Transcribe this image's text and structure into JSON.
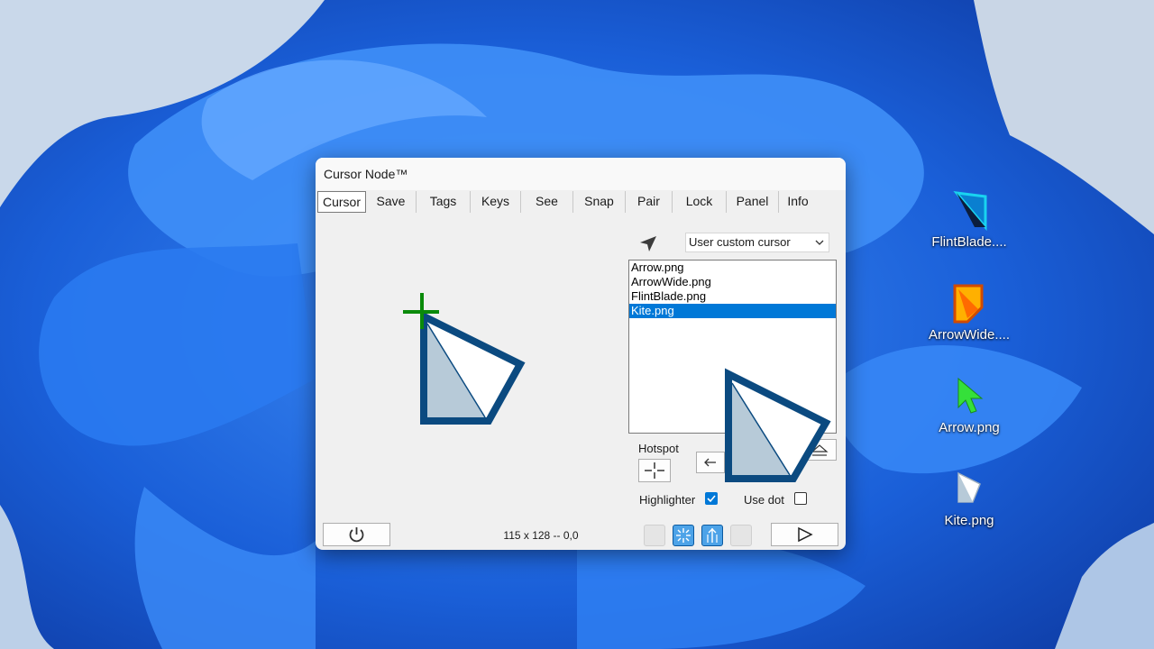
{
  "window": {
    "title": "Cursor Node™"
  },
  "tabs": [
    {
      "label": "Cursor",
      "active": true
    },
    {
      "label": "Save"
    },
    {
      "label": "Tags"
    },
    {
      "label": "Keys"
    },
    {
      "label": "See"
    },
    {
      "label": "Snap"
    },
    {
      "label": "Pair"
    },
    {
      "label": "Lock"
    },
    {
      "label": "Panel"
    },
    {
      "label": "Info"
    }
  ],
  "cursor_source": {
    "selected": "User custom cursor"
  },
  "cursor_files": [
    {
      "name": "Arrow.png"
    },
    {
      "name": "ArrowWide.png"
    },
    {
      "name": "FlintBlade.png"
    },
    {
      "name": "Kite.png",
      "selected": true
    }
  ],
  "hotspot": {
    "label": "Hotspot"
  },
  "options": {
    "highlighter_label": "Highlighter",
    "highlighter_checked": true,
    "use_dot_label": "Use dot",
    "use_dot_checked": false
  },
  "status": {
    "text": "115 x 128 -- 0,0"
  },
  "colors": {
    "accent": "#0078d7",
    "cursor_outline": "#0b4a80",
    "cursor_shade": "#b7cad8",
    "hotspot_marker": "#0a8a0a"
  },
  "desktop_icons": [
    {
      "label": "FlintBlade....",
      "icon": "flintblade-cursor-icon"
    },
    {
      "label": "ArrowWide....",
      "icon": "arrowwide-cursor-icon"
    },
    {
      "label": "Arrow.png",
      "icon": "arrow-cursor-icon"
    },
    {
      "label": "Kite.png",
      "icon": "kite-cursor-icon"
    }
  ]
}
